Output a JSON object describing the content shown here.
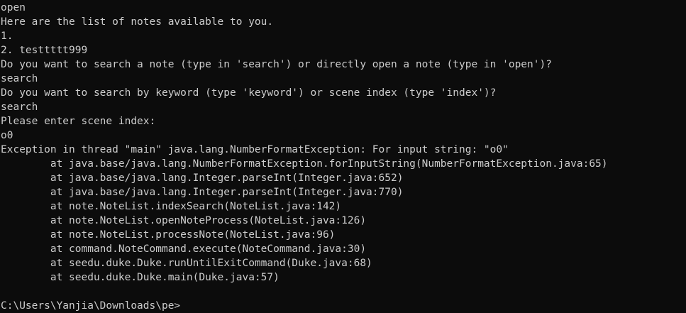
{
  "colors": {
    "background": "#0c0c0c",
    "foreground": "#cccccc"
  },
  "terminal": {
    "lines": [
      "open",
      "Here are the list of notes available to you.",
      "1.",
      "2. testtttt999",
      "Do you want to search a note (type in 'search') or directly open a note (type in 'open')?",
      "search",
      "Do you want to search by keyword (type 'keyword') or scene index (type 'index')?",
      "search",
      "Please enter scene index:",
      "o0",
      "Exception in thread \"main\" java.lang.NumberFormatException: For input string: \"o0\"",
      "        at java.base/java.lang.NumberFormatException.forInputString(NumberFormatException.java:65)",
      "        at java.base/java.lang.Integer.parseInt(Integer.java:652)",
      "        at java.base/java.lang.Integer.parseInt(Integer.java:770)",
      "        at note.NoteList.indexSearch(NoteList.java:142)",
      "        at note.NoteList.openNoteProcess(NoteList.java:126)",
      "        at note.NoteList.processNote(NoteList.java:96)",
      "        at command.NoteCommand.execute(NoteCommand.java:30)",
      "        at seedu.duke.Duke.runUntilExitCommand(Duke.java:68)",
      "        at seedu.duke.Duke.main(Duke.java:57)",
      ""
    ],
    "prompt": "C:\\Users\\Yanjia\\Downloads\\pe>"
  }
}
